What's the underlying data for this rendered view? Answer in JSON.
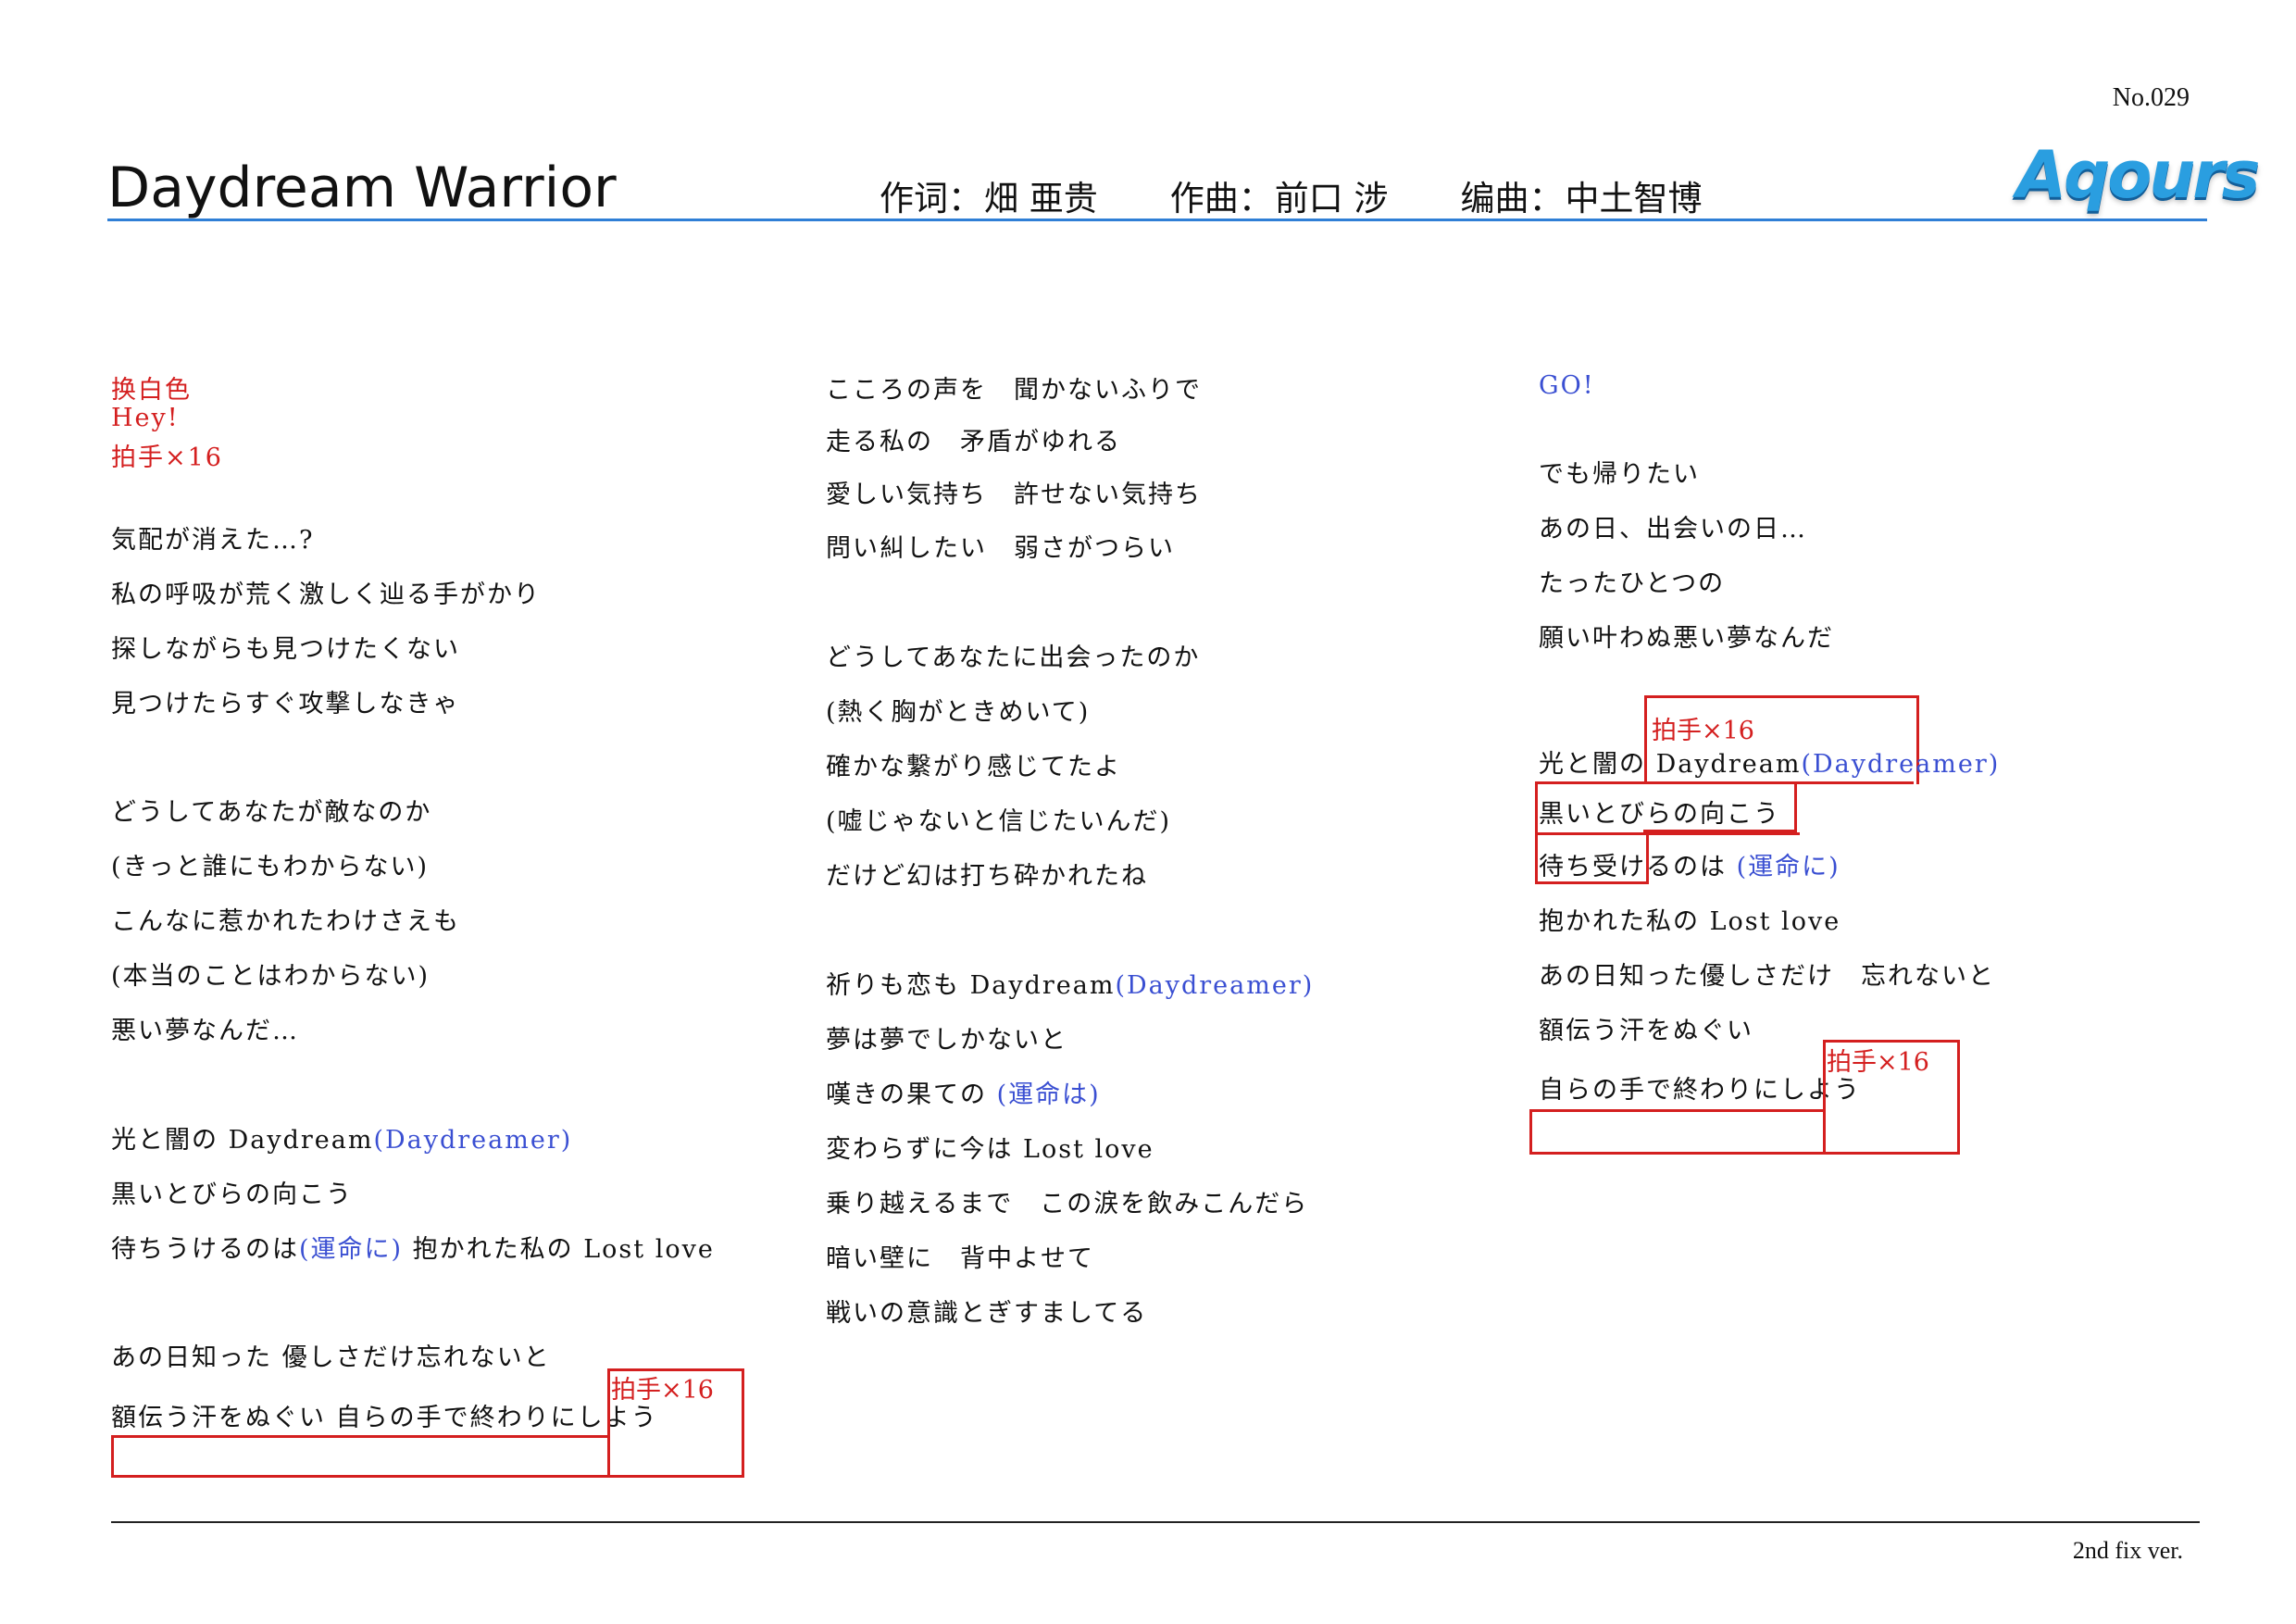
{
  "doc_number": "No.029",
  "song_title": "Daydream Warrior",
  "credits": [
    {
      "label": "作词：",
      "name": "畑 亜贵"
    },
    {
      "label": "作曲：",
      "name": "前口 涉"
    },
    {
      "label": "编曲：",
      "name": "中土智博"
    }
  ],
  "logo_text": "Aqours",
  "version": "2nd fix ver.",
  "col1": {
    "intro_1": "换白色",
    "intro_2": "Hey!",
    "intro_3": "拍手×16",
    "v1": [
      "気配が消えた…?",
      "私の呼吸が荒く激しく辿る手がかり",
      "探しながらも見つけたくない",
      "見つけたらすぐ攻撃しなきゃ"
    ],
    "v2": [
      "どうしてあなたが敵なのか",
      "(きっと誰にもわからない)",
      "こんなに惹かれたわけさえも",
      "(本当のことはわからない)",
      "悪い夢なんだ…"
    ],
    "c1a": "光と闇の Daydream",
    "c1a_call": "(Daydreamer)",
    "c1b": "黒いとびらの向こう",
    "c1c_1": "待ちうけるのは",
    "c1c_call": "(運命に)",
    "c1c_2": " 抱かれた私の Lost love",
    "c1d": "あの日知った 優しさだけ忘れないと",
    "c1e": "額伝う汗をぬぐい 自らの手で終わりにしよう",
    "cue": "拍手×16"
  },
  "col2": {
    "v3": [
      "こころの声を　聞かないふりで",
      "走る私の　矛盾がゆれる",
      "愛しい気持ち　許せない気持ち",
      "問い糾したい　弱さがつらい"
    ],
    "v4": [
      "どうしてあなたに出会ったのか",
      "(熱く胸がときめいて)",
      "確かな繋がり感じてたよ",
      "(嘘じゃないと信じたいんだ)",
      "だけど幻は打ち砕かれたね"
    ],
    "c2a": "祈りも恋も Daydream",
    "c2a_call": "(Daydreamer)",
    "c2b": "夢は夢でしかないと",
    "c2c": "嘆きの果ての ",
    "c2c_call": "(運命は)",
    "c2rest": [
      "変わらずに今は Lost love",
      "乗り越えるまで　この涙を飲みこんだら",
      "暗い壁に　背中よせて",
      "戦いの意識とぎすましてる"
    ]
  },
  "col3": {
    "go": "GO!",
    "v5": [
      "でも帰りたい",
      "あの日、出会いの日…",
      "たったひとつの",
      "願い叶わぬ悪い夢なんだ"
    ],
    "cue_a": "拍手×16",
    "c3a": "光と闇の Daydream",
    "c3a_call": "(Daydreamer)",
    "c3b": "黒いとびらの向こう",
    "c3c": "待ち受けるのは ",
    "c3c_call": "(運命に)",
    "c3rest": [
      "抱かれた私の Lost love",
      "あの日知った優しさだけ　忘れないと",
      "額伝う汗をぬぐい"
    ],
    "c3last": "自らの手で終わりにしよう",
    "cue_b": "拍手×16"
  }
}
